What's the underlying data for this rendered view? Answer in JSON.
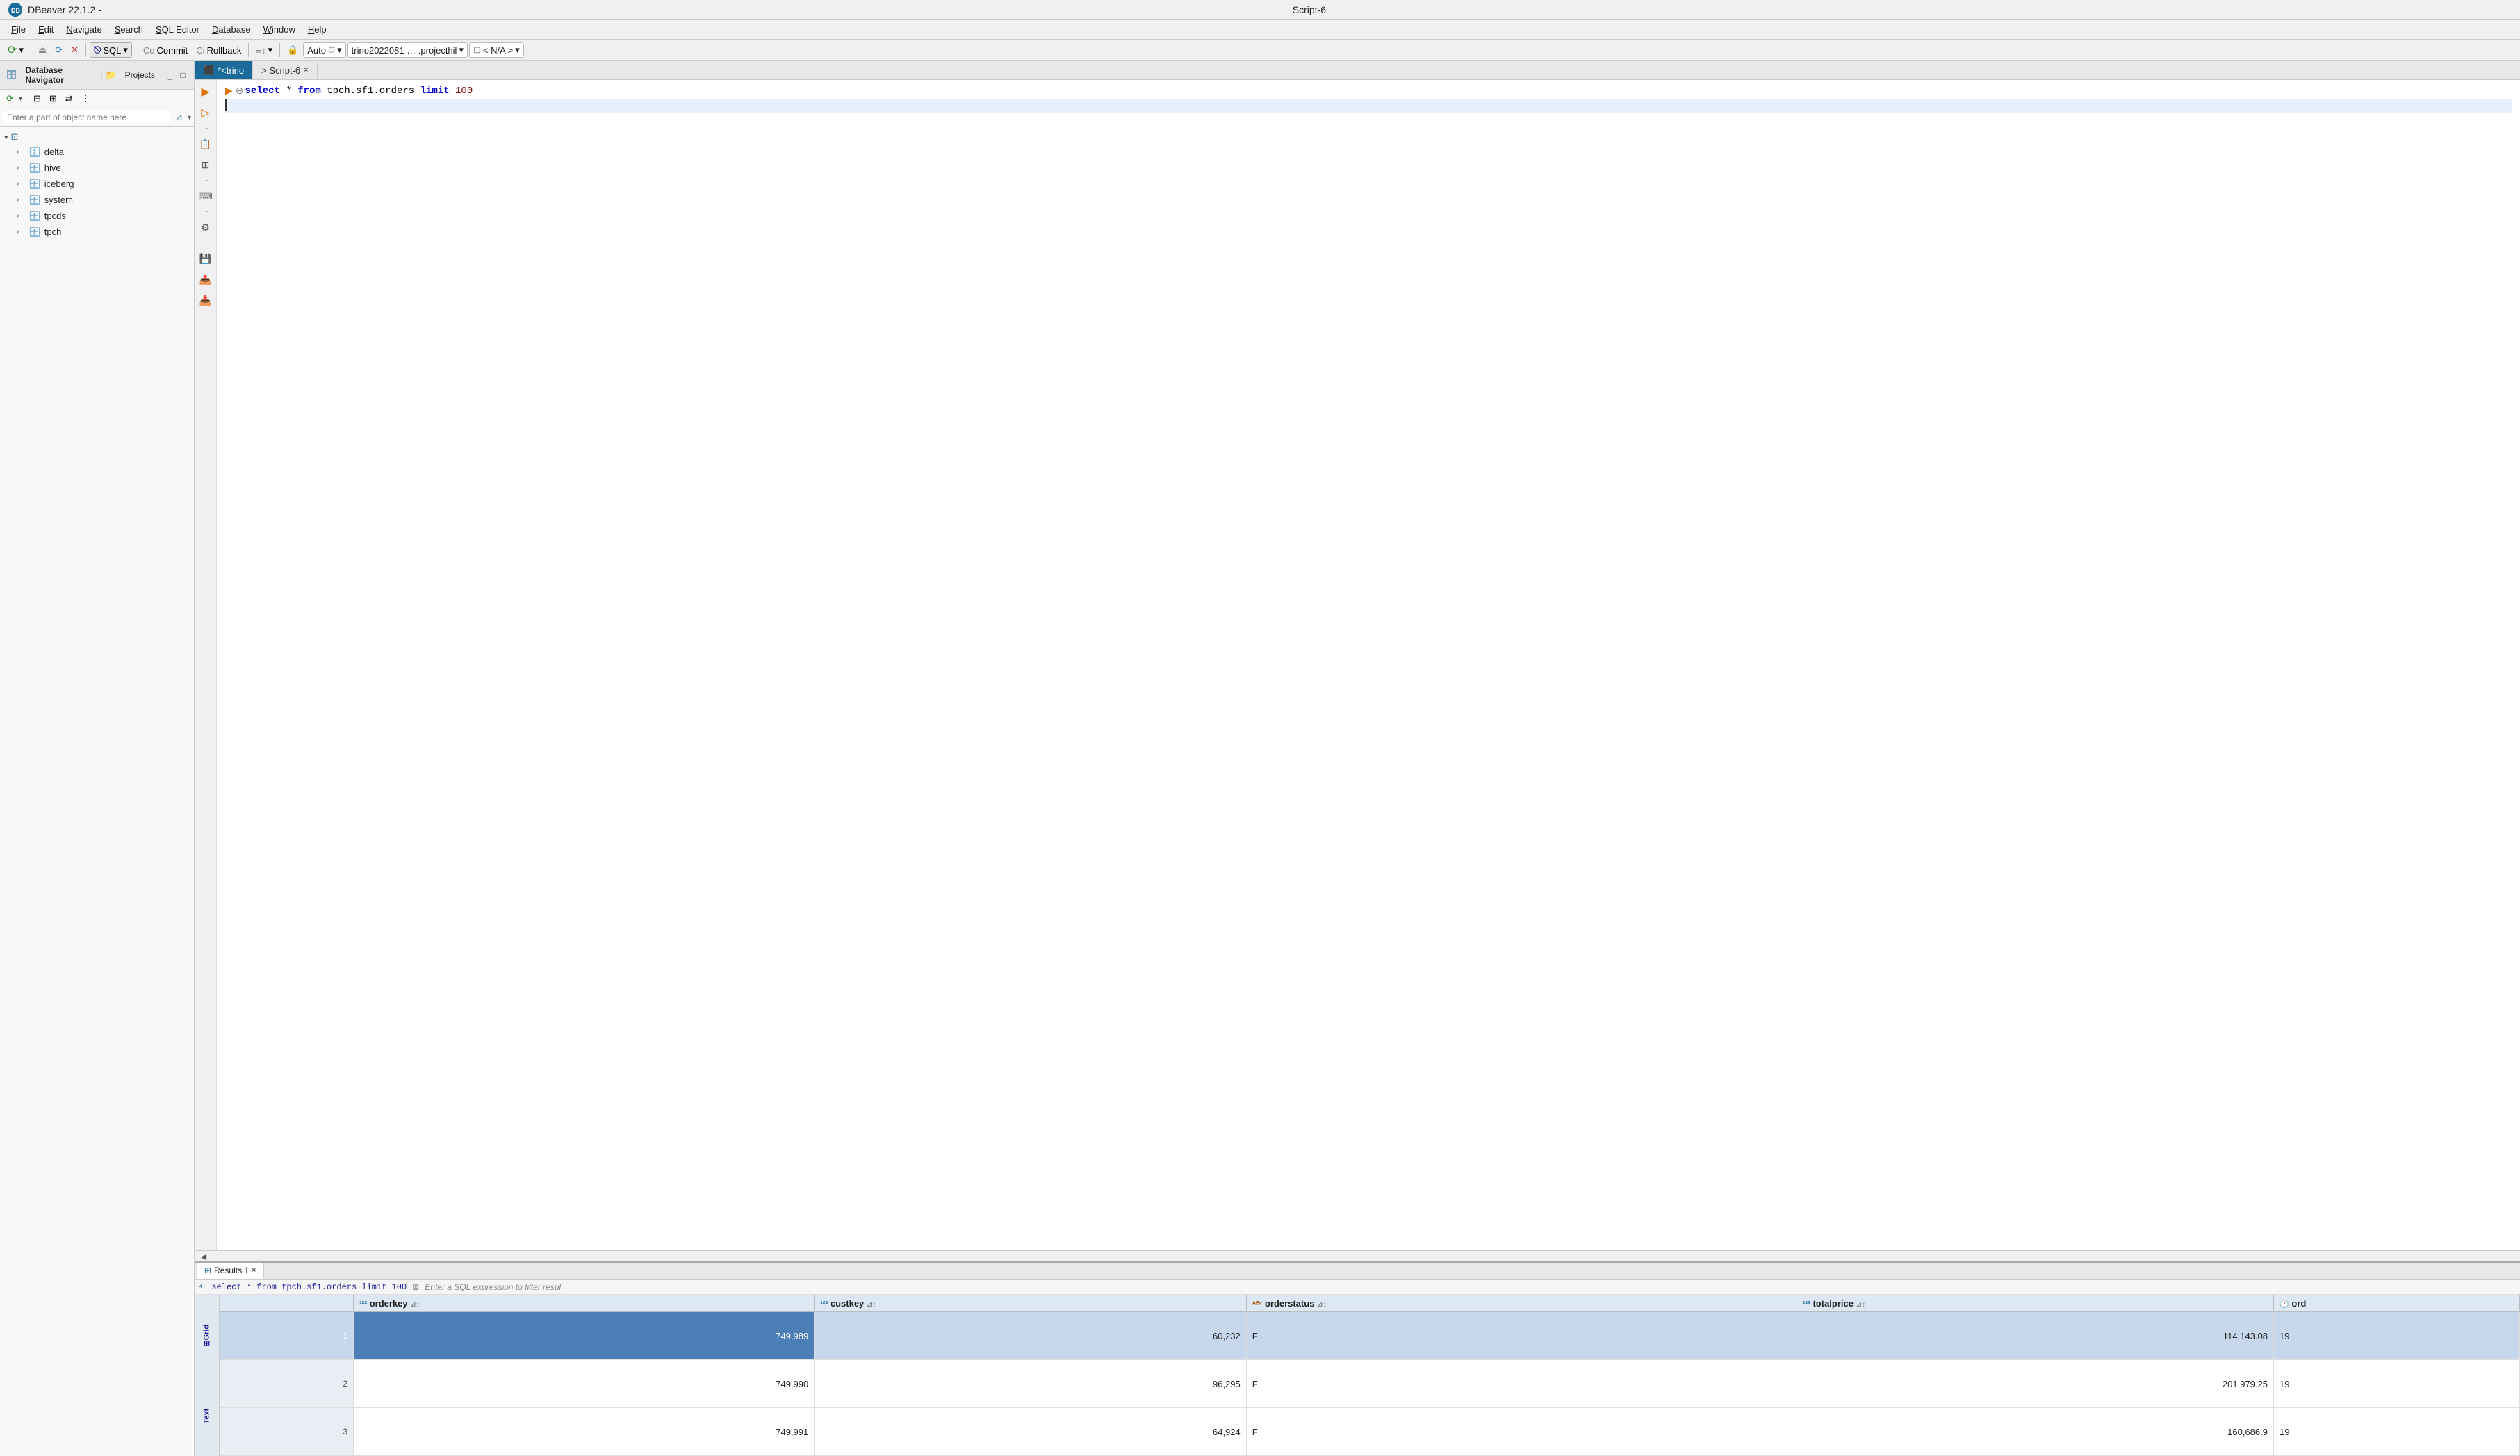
{
  "app": {
    "title": "DBeaver 22.1.2 -",
    "script_title": "Script-6",
    "logo_text": "DB"
  },
  "menu": {
    "items": [
      "File",
      "Edit",
      "Navigate",
      "Search",
      "SQL Editor",
      "Database",
      "Window",
      "Help"
    ]
  },
  "toolbar": {
    "sql_label": "SQL",
    "commit_label": "Commit",
    "rollback_label": "Rollback",
    "auto_label": "Auto",
    "connection_label": "trino2022081 … .projecthil",
    "schema_label": "< N/A >"
  },
  "left_panel": {
    "tab_db_navigator": "Database Navigator",
    "tab_projects": "Projects",
    "search_placeholder": "Enter a part of object name here",
    "tree_items": [
      {
        "name": "delta",
        "type": "database",
        "expanded": false
      },
      {
        "name": "hive",
        "type": "database",
        "expanded": false
      },
      {
        "name": "iceberg",
        "type": "database",
        "expanded": false
      },
      {
        "name": "system",
        "type": "database",
        "expanded": false
      },
      {
        "name": "tpcds",
        "type": "database",
        "expanded": false
      },
      {
        "name": "tpch",
        "type": "database",
        "expanded": false
      }
    ]
  },
  "editor": {
    "tab_trino": "*<trino",
    "tab_script": "> Script-6",
    "sql_content": "select * from tpch.sf1.orders limit 100"
  },
  "results": {
    "tab_label": "Results 1",
    "query_text": "select * from tpch.sf1.orders limit 100",
    "filter_placeholder": "Enter a SQL expression to filter resul",
    "columns": [
      {
        "type_icon": "123",
        "name": "orderkey"
      },
      {
        "type_icon": "123",
        "name": "custkey"
      },
      {
        "type_icon": "ABC",
        "name": "orderstatus"
      },
      {
        "type_icon": "123",
        "name": "totalprice"
      },
      {
        "type_icon": "clock",
        "name": "ord"
      }
    ],
    "rows": [
      {
        "num": "1",
        "orderkey": "749,989",
        "custkey": "60,232",
        "orderstatus": "F",
        "totalprice": "114,143.08",
        "orderdate": "19",
        "selected": true
      },
      {
        "num": "2",
        "orderkey": "749,990",
        "custkey": "96,295",
        "orderstatus": "F",
        "totalprice": "201,979.25",
        "orderdate": "19",
        "selected": false
      },
      {
        "num": "3",
        "orderkey": "749,991",
        "custkey": "64,924",
        "orderstatus": "F",
        "totalprice": "160,686.9",
        "orderdate": "19",
        "selected": false
      }
    ]
  },
  "icons": {
    "chevron_right": "›",
    "chevron_down": "˅",
    "close": "×",
    "run": "▶",
    "commit": "Co",
    "rollback": "Ci",
    "grid_icon": "⊞",
    "filter_icon": "⊿",
    "settings_icon": "⚙",
    "terminal_icon": "⌨",
    "save_icon": "💾",
    "arrow_left": "◄"
  }
}
